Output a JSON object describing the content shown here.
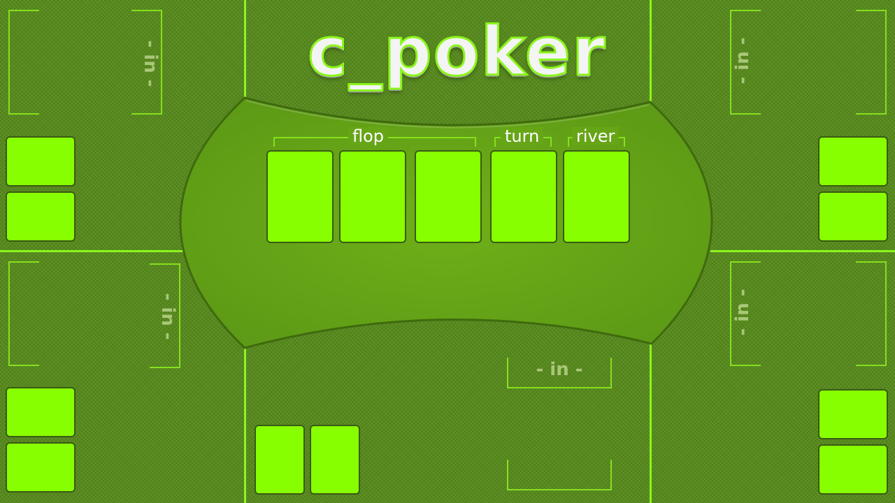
{
  "app": {
    "title": "c_poker"
  },
  "board": {
    "labels": {
      "flop": "flop",
      "turn": "turn",
      "river": "river"
    },
    "cards": [
      "",
      "",
      "",
      "",
      ""
    ]
  },
  "seats": {
    "top_left": {
      "label": "- in -"
    },
    "top_right": {
      "label": "- in -"
    },
    "mid_left": {
      "label": "- in -"
    },
    "mid_right": {
      "label": "- in -"
    },
    "bottom": {
      "label": "- in -"
    }
  },
  "colors": {
    "felt": "#55891a",
    "table": "#66a616",
    "accent": "#8cf51c",
    "card": "#88ff00",
    "label": "#a9c778"
  }
}
